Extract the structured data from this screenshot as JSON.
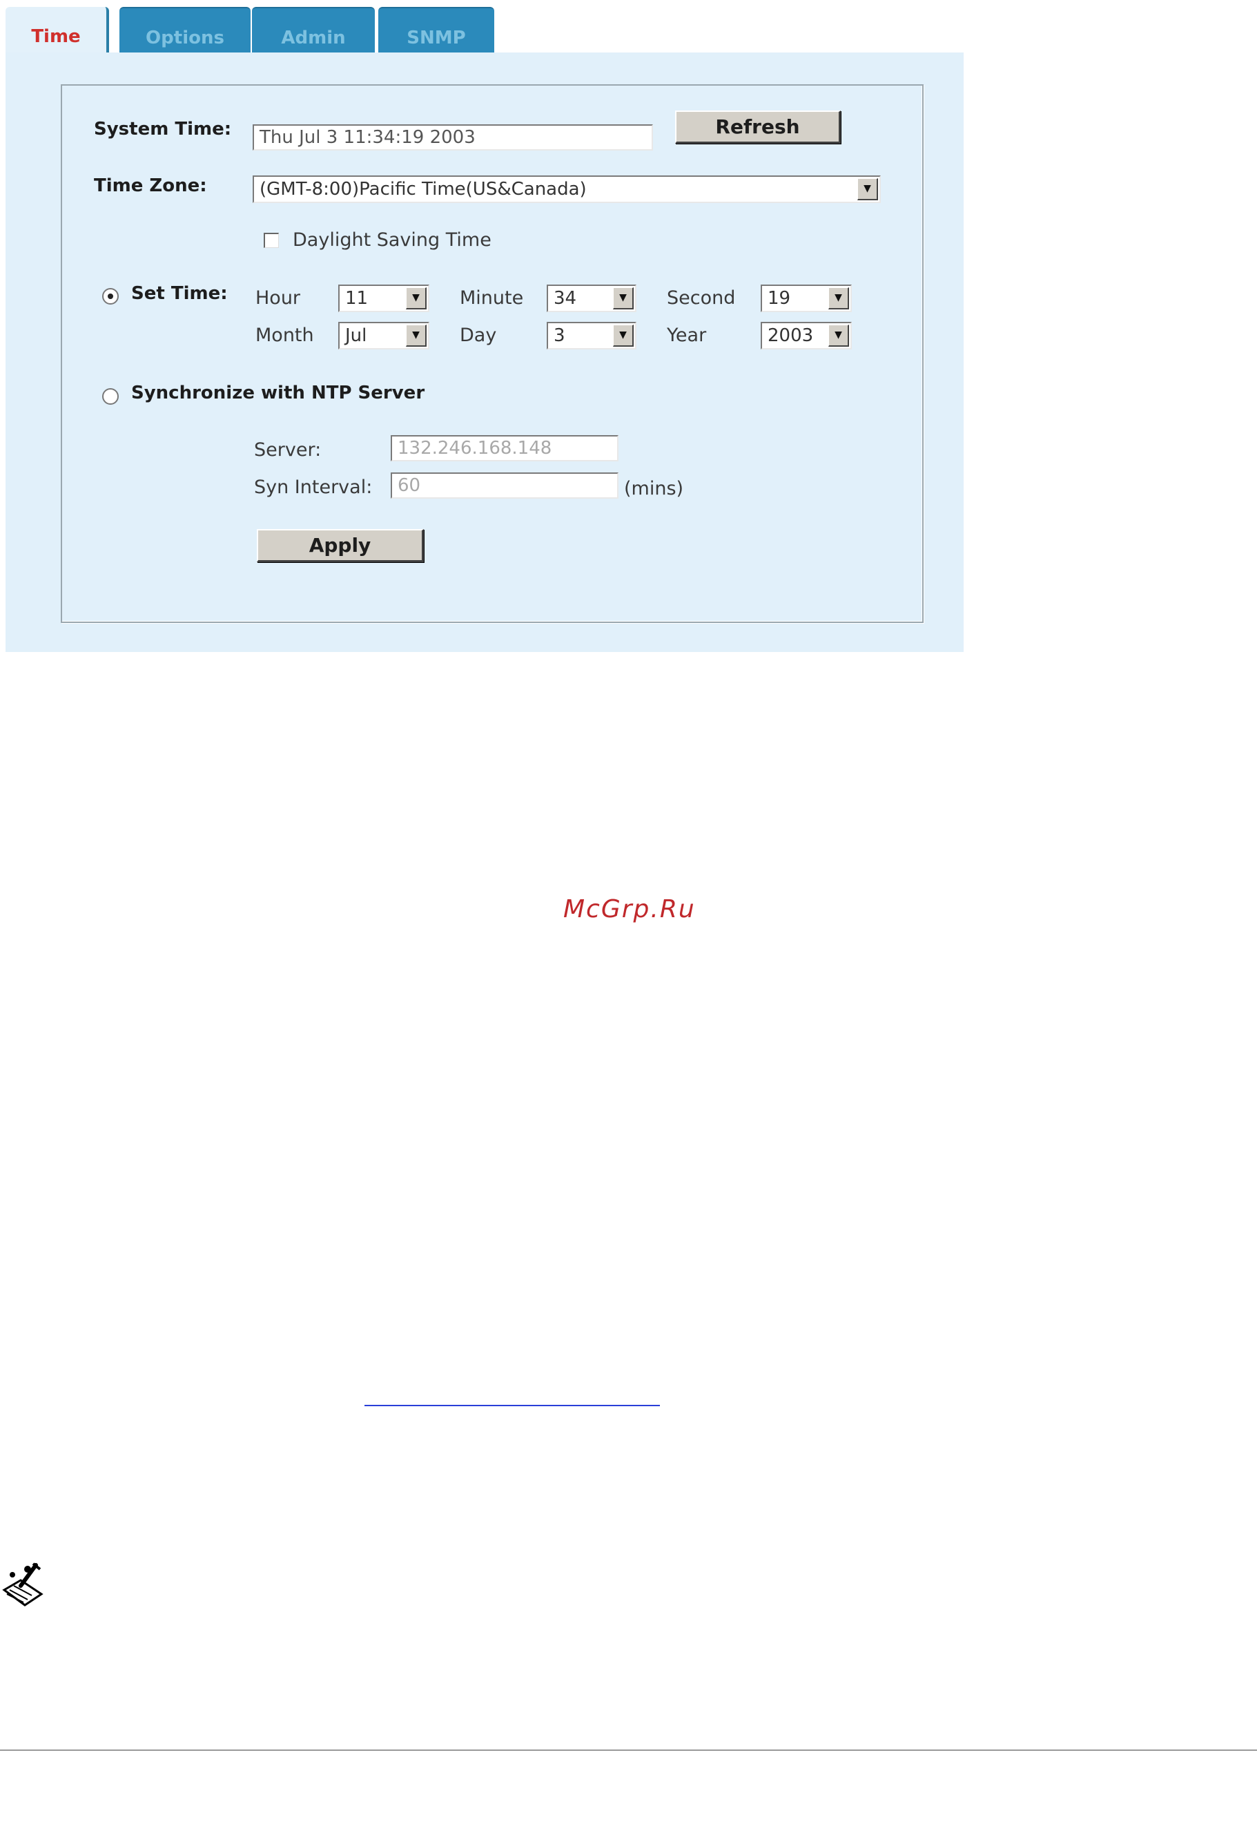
{
  "tabs": [
    {
      "label": "Time",
      "active": true
    },
    {
      "label": "Options",
      "active": false
    },
    {
      "label": "Admin",
      "active": false
    },
    {
      "label": "SNMP",
      "active": false
    }
  ],
  "form": {
    "system_time_label": "System Time:",
    "system_time_value": "Thu Jul  3 11:34:19 2003",
    "refresh_label": "Refresh",
    "time_zone_label": "Time Zone:",
    "time_zone_value": "(GMT-8:00)Pacific Time(US&Canada)",
    "daylight_label": "Daylight Saving Time",
    "daylight_checked": false,
    "set_time_label": "Set Time:",
    "set_time_selected": true,
    "hour_label": "Hour",
    "hour_value": "11",
    "minute_label": "Minute",
    "minute_value": "34",
    "second_label": "Second",
    "second_value": "19",
    "month_label": "Month",
    "month_value": "Jul",
    "day_label": "Day",
    "day_value": "3",
    "year_label": "Year",
    "year_value": "2003",
    "ntp_label": "Synchronize with NTP Server",
    "ntp_selected": false,
    "server_label": "Server:",
    "server_value": "132.246.168.148",
    "interval_label": "Syn Interval:",
    "interval_value": "60",
    "interval_unit": "(mins)",
    "apply_label": "Apply"
  },
  "watermark": "McGrp.Ru",
  "colors": {
    "panel_bg": "#e1f0fa",
    "tab_active_text": "#d0302c",
    "tab_inactive_bg": "#2b8abb",
    "watermark": "#c0282b"
  }
}
